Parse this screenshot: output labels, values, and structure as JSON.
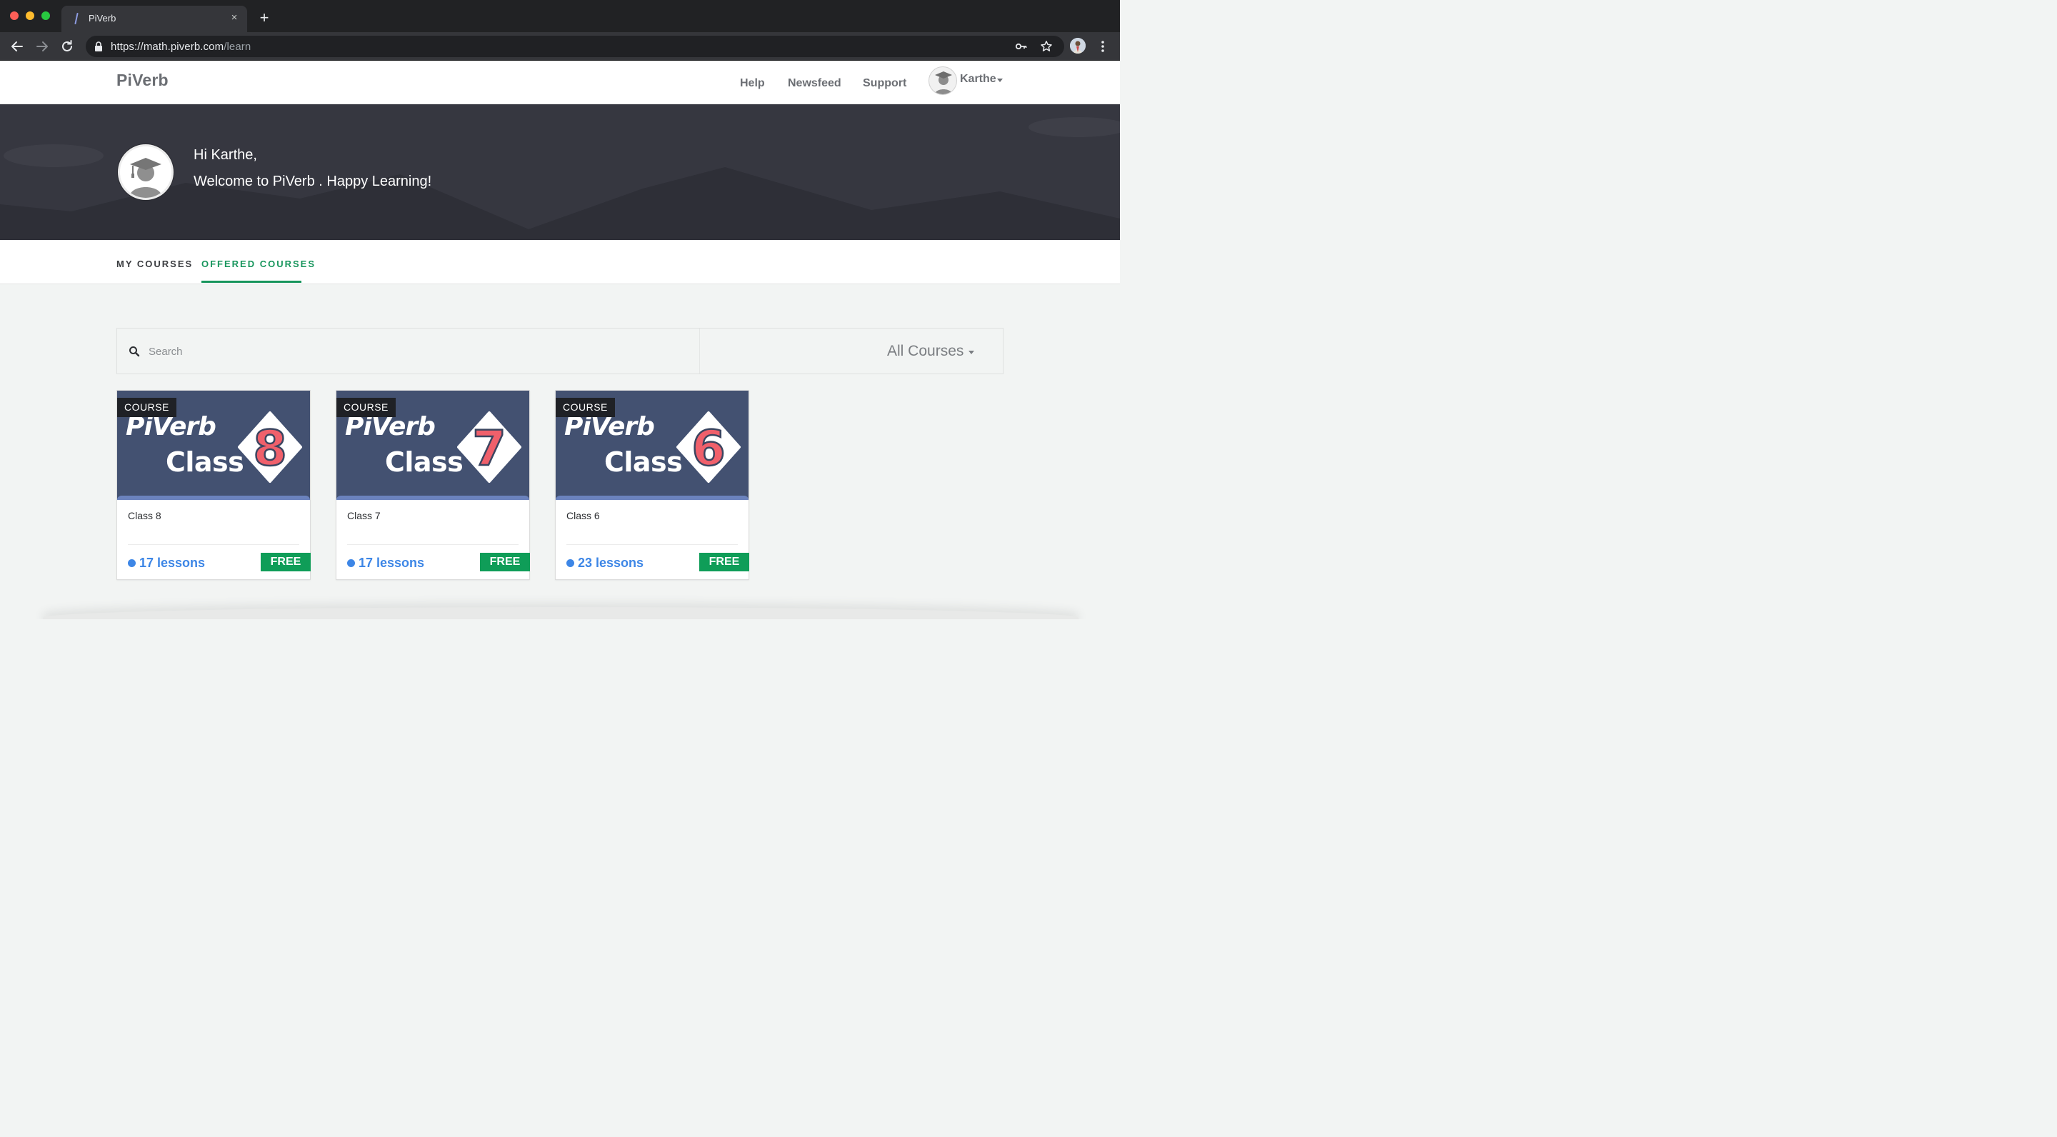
{
  "browser": {
    "tab_title": "PiVerb",
    "tab_close_glyph": "×",
    "new_tab_glyph": "+",
    "url_host": "https://math.piverb.com",
    "url_path": "/learn"
  },
  "header": {
    "brand": "PiVerb",
    "nav": [
      {
        "label": "Help"
      },
      {
        "label": "Newsfeed"
      },
      {
        "label": "Support"
      }
    ],
    "user_name": "Karthe"
  },
  "hero": {
    "greeting": "Hi Karthe,",
    "welcome": "Welcome to PiVerb . Happy Learning!"
  },
  "tabs": {
    "my_courses": "MY COURSES",
    "offered_courses": "OFFERED COURSES",
    "active": "offered_courses"
  },
  "search": {
    "placeholder": "Search",
    "value": "",
    "filter_label": "All Courses"
  },
  "courses": [
    {
      "badge": "COURSE",
      "thumb_brand": "PiVerb",
      "thumb_class": "Class",
      "digit": "8",
      "title": "Class 8",
      "lessons": "17 lessons",
      "price": "FREE"
    },
    {
      "badge": "COURSE",
      "thumb_brand": "PiVerb",
      "thumb_class": "Class",
      "digit": "7",
      "title": "Class 7",
      "lessons": "17 lessons",
      "price": "FREE"
    },
    {
      "badge": "COURSE",
      "thumb_brand": "PiVerb",
      "thumb_class": "Class",
      "digit": "6",
      "title": "Class 6",
      "lessons": "23 lessons",
      "price": "FREE"
    }
  ],
  "colors": {
    "accent_green": "#17955c",
    "free_green": "#0f9d58",
    "lesson_blue": "#3d86e6",
    "hero_bg": "#363740",
    "thumb_bg": "#435171",
    "digit_pink": "#f0606b"
  },
  "icons": [
    "back-arrow-icon",
    "forward-arrow-icon",
    "reload-icon",
    "lock-icon",
    "key-icon",
    "star-icon",
    "kebab-menu-icon",
    "search-icon",
    "graduate-avatar-icon",
    "caret-down-icon"
  ]
}
